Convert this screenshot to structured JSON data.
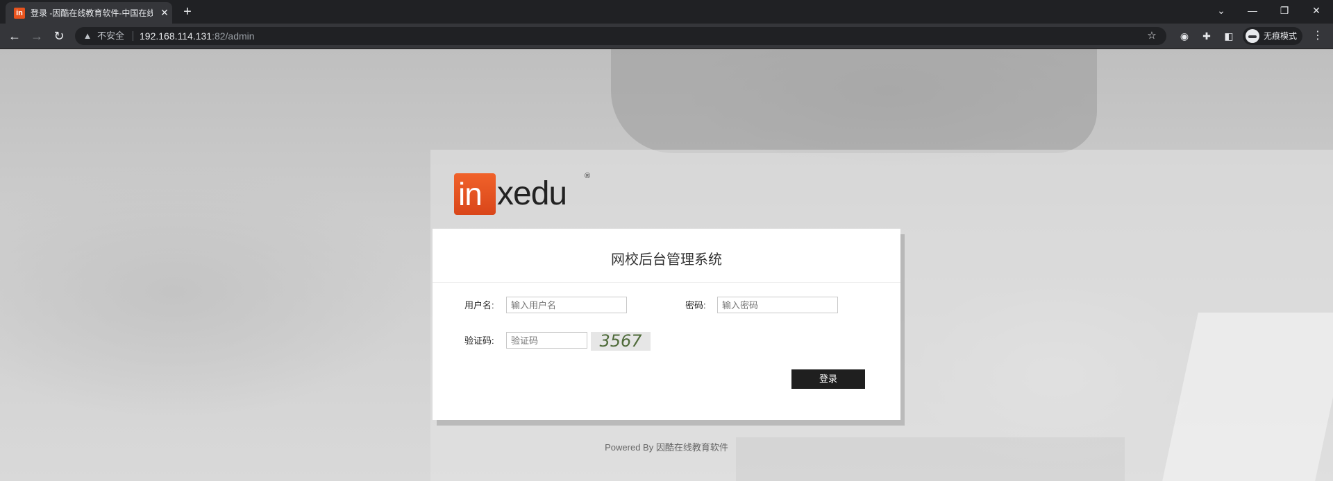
{
  "browser": {
    "tab_icon_text": "in",
    "tab_title": "登录 -因酷在线教育软件-中国在线教育软件",
    "security_label": "不安全",
    "url_host": "192.168.114.131",
    "url_rest": ":82/admin",
    "incognito_label": "无痕模式"
  },
  "logo": {
    "in_text": "in",
    "rest_text": "xedu",
    "reg_mark": "®"
  },
  "login": {
    "title": "网校后台管理系统",
    "username_label": "用户名:",
    "username_placeholder": "输入用户名",
    "password_label": "密码:",
    "password_placeholder": "输入密码",
    "captcha_label": "验证码:",
    "captcha_placeholder": "验证码",
    "captcha_code": "3567",
    "submit_label": "登录"
  },
  "footer": {
    "text": "Powered By 因酷在线教育软件"
  },
  "colors": {
    "logo_orange": "#e8531d",
    "button_bg": "#1f1f1f",
    "captcha_text": "#4f6b3a"
  }
}
